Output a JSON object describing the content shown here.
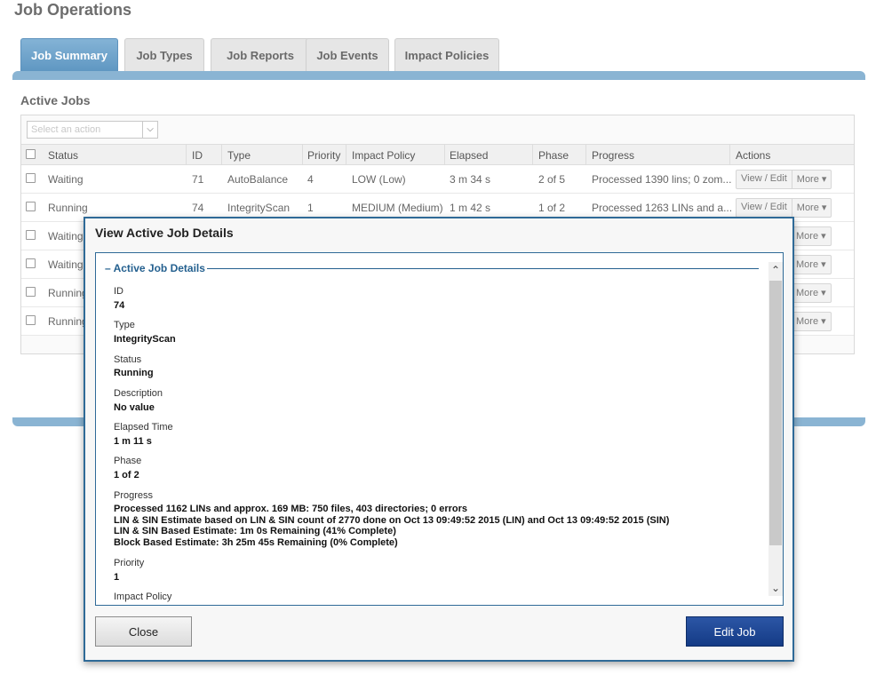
{
  "page": {
    "title": "Job Operations"
  },
  "tabs": [
    {
      "label": "Job Summary",
      "active": true
    },
    {
      "label": "Job Types",
      "active": false
    },
    {
      "label": "Job Reports",
      "active": false
    },
    {
      "label": "Job Events",
      "active": false
    },
    {
      "label": "Impact Policies",
      "active": false
    }
  ],
  "active_jobs": {
    "title": "Active Jobs",
    "action_placeholder": "Select an action",
    "columns": [
      "Status",
      "ID",
      "Type",
      "Priority",
      "Impact Policy",
      "Elapsed",
      "Phase",
      "Progress",
      "Actions"
    ],
    "rows": [
      {
        "status": "Waiting",
        "id": "71",
        "type": "AutoBalance",
        "priority": "4",
        "impact": "LOW (Low)",
        "elapsed": "3 m 34 s",
        "phase": "2 of 5",
        "progress": "Processed 1390 lins; 0 zom...",
        "view_edit": "View / Edit",
        "more": "More ▾"
      },
      {
        "status": "Running",
        "id": "74",
        "type": "IntegrityScan",
        "priority": "1",
        "impact": "MEDIUM (Medium)",
        "elapsed": "1 m 42 s",
        "phase": "1 of 2",
        "progress": "Processed 1263 LINs and a...",
        "view_edit": "View / Edit",
        "more": "More ▾"
      },
      {
        "status": "Waiting",
        "more": "More ▾"
      },
      {
        "status": "Waiting",
        "more": "More ▾"
      },
      {
        "status": "Running",
        "more": "More ▾"
      },
      {
        "status": "Running",
        "more": "More ▾"
      }
    ]
  },
  "modal": {
    "title": "View Active Job Details",
    "section_legend": "Active Job Details",
    "fields": [
      {
        "label": "ID",
        "value": "74"
      },
      {
        "label": "Type",
        "value": "IntegrityScan"
      },
      {
        "label": "Status",
        "value": "Running"
      },
      {
        "label": "Description",
        "value": "No value"
      },
      {
        "label": "Elapsed Time",
        "value": "1 m 11 s"
      },
      {
        "label": "Phase",
        "value": "1 of 2"
      },
      {
        "label": "Progress",
        "value_lines": [
          "Processed 1162 LINs and approx. 169 MB: 750 files, 403 directories; 0 errors",
          "LIN & SIN Estimate based on LIN & SIN count of 2770 done on Oct 13 09:49:52 2015 (LIN) and Oct 13 09:49:52 2015 (SIN)",
          "LIN & SIN Based Estimate: 1m 0s Remaining (41% Complete)",
          "Block Based Estimate: 3h 25m 45s Remaining (0% Complete)"
        ]
      },
      {
        "label": "Priority",
        "value": "1"
      },
      {
        "label": "Impact Policy"
      }
    ],
    "close_label": "Close",
    "edit_label": "Edit Job"
  }
}
